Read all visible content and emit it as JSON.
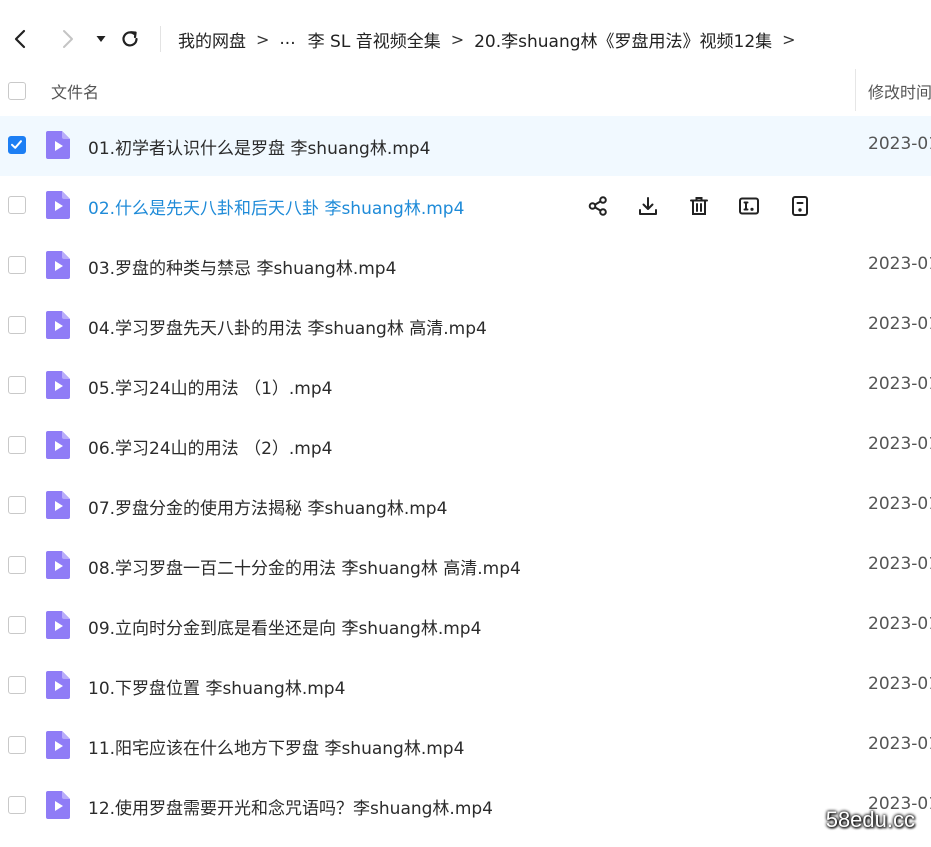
{
  "breadcrumb": {
    "items": [
      "我的网盘",
      "...",
      "李 SL 音视频全集",
      "20.李shuang林《罗盘用法》视频12集"
    ],
    "separator": ">"
  },
  "header": {
    "name_label": "文件名",
    "date_label": "修改时间"
  },
  "files": [
    {
      "name": "01.初学者认识什么是罗盘 李shuang林.mp4",
      "date": "2023-01"
    },
    {
      "name": "02.什么是先天八卦和后天八卦 李shuang林.mp4",
      "date": ""
    },
    {
      "name": "03.罗盘的种类与禁忌 李shuang林.mp4",
      "date": "2023-01"
    },
    {
      "name": "04.学习罗盘先天八卦的用法 李shuang林 高清.mp4",
      "date": "2023-01"
    },
    {
      "name": "05.学习24山的用法 （1）.mp4",
      "date": "2023-01"
    },
    {
      "name": "06.学习24山的用法 （2）.mp4",
      "date": "2023-01"
    },
    {
      "name": "07.罗盘分金的使用方法揭秘 李shuang林.mp4",
      "date": "2023-01"
    },
    {
      "name": "08.学习罗盘一百二十分金的用法 李shuang林 高清.mp4",
      "date": "2023-01"
    },
    {
      "name": "09.立向时分金到底是看坐还是向 李shuang林.mp4",
      "date": "2023-01"
    },
    {
      "name": "10.下罗盘位置 李shuang林.mp4",
      "date": "2023-01"
    },
    {
      "name": "11.阳宅应该在什么地方下罗盘 李shuang林.mp4",
      "date": "2023-01"
    },
    {
      "name": "12.使用罗盘需要开光和念咒语吗？李shuang林.mp4",
      "date": "2023-01"
    }
  ],
  "row_actions": [
    "share-icon",
    "download-icon",
    "delete-icon",
    "rename-icon",
    "more-icon"
  ],
  "colors": {
    "accent": "#1d7ff4",
    "hover_text": "#1f8bd8",
    "selected_row": "#f1f9ff",
    "video_icon": "#8f7cf6"
  },
  "watermark": "58edu.cc"
}
